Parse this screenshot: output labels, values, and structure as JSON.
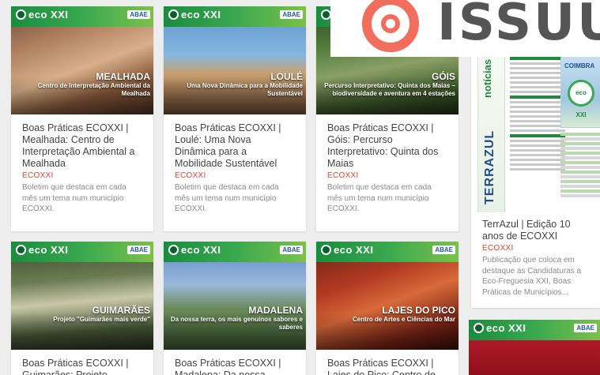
{
  "overlay": {
    "brand": "ISSUU"
  },
  "eco_header": {
    "logo": "eco XXI",
    "partner": "ABAE"
  },
  "cards": [
    {
      "place": "MEALHADA",
      "tagline": "Centro de Interpretação Ambiental da Mealhada",
      "title": "Boas Práticas ECOXXI | Mealhada: Centro de Interpretação Ambiental a Mealhada",
      "category": "ECOXXI",
      "description": "Boletim que destaca em cada mês um tema num município ECOXXI."
    },
    {
      "place": "LOULÉ",
      "tagline": "Uma Nova Dinâmica para a Mobilidade Sustentável",
      "title": "Boas Práticas ECOXXI | Loulé: Uma Nova Dinâmica para a Mobilidade Sustentável",
      "category": "ECOXXI",
      "description": "Boletim que destaca em cada mês um tema num município ECOXXI."
    },
    {
      "place": "GÓIS",
      "tagline": "Percurso Interpretativo: Quinta dos Maias – biodiversidade e aventura em 4 estações",
      "title": "Boas Práticas ECOXXI | Góis: Percurso Interpretativo: Quinta dos Maias",
      "category": "ECOXXI",
      "description": "Boletim que destaca em cada mês um tema num município ECOXXI."
    },
    {
      "place": "GUIMARÃES",
      "tagline": "Projeto \"Guimarães mais verde\"",
      "title": "Boas Práticas ECOXXI | Guimarães: Projeto",
      "category": "",
      "description": ""
    },
    {
      "place": "MADALENA",
      "tagline": "Da nossa terra, os mais genuínos sabores e saberes",
      "title": "Boas Práticas ECOXXI | Madalena: Da nossa",
      "category": "",
      "description": ""
    },
    {
      "place": "LAJES DO PICO",
      "tagline": "Centro de Artes e Ciências do Mar",
      "title": "Boas Práticas ECOXXI | Lajes do Pico: Centro de",
      "category": "",
      "description": ""
    }
  ],
  "magazine": {
    "side_label": "notícias",
    "side_title": "TERRAZUL",
    "cover_city": "COIMBRA",
    "cover_badge": "eco XXI",
    "title": "TerrAzul | Edição 10 anos de ECOXXI",
    "category": "ECOXXI",
    "description": "Publicação que coloca em destaque as Candidaturas a Eco-Freguesia XXI, Boas Práticas de Municípios..."
  }
}
